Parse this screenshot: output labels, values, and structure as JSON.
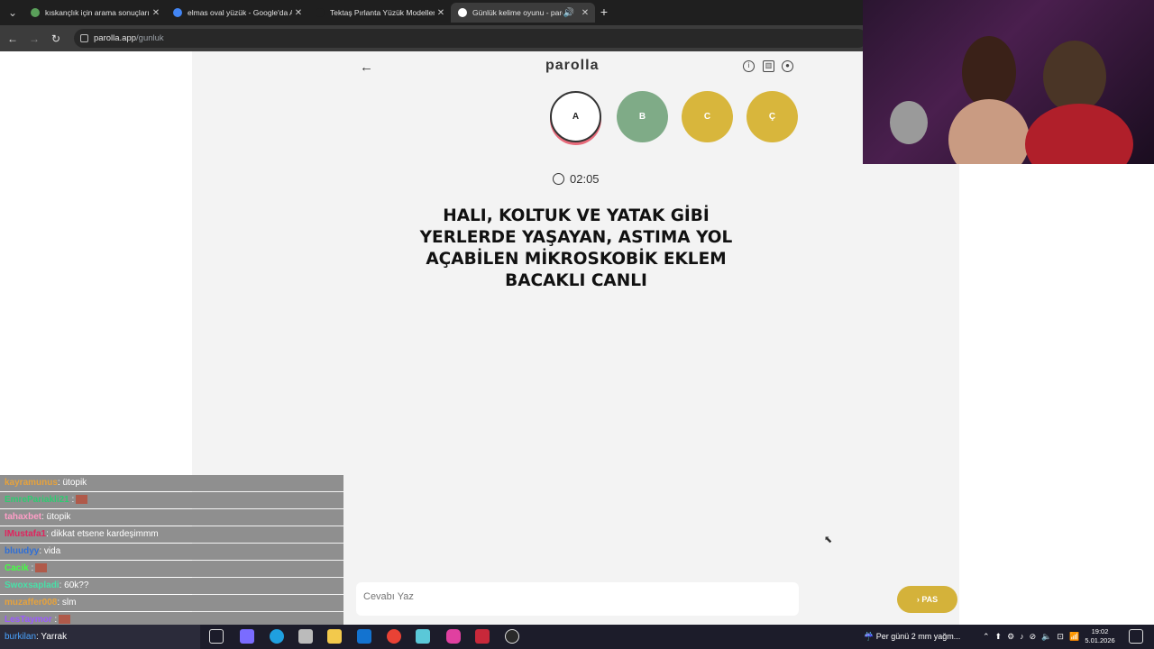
{
  "browser": {
    "tabs": [
      {
        "title": "kıskançlık için arama sonuçları -"
      },
      {
        "title": "elmas oval yüzük - Google'da A"
      },
      {
        "title": "Tektaş Pırlanta Yüzük Modelleri"
      },
      {
        "title": "Günlük kelime oyunu - paro"
      }
    ],
    "url_host": "parolla.app",
    "url_path": "/gunluk"
  },
  "game": {
    "logo": "parolla",
    "letters": [
      "A",
      "B",
      "C",
      "Ç"
    ],
    "timer": "02:05",
    "question": "HALI, KOLTUK VE YATAK GİBİ YERLERDE YAŞAYAN, ASTIMA YOL AÇABİLEN MİKROSKOBİK EKLEM BACAKLI CANLI",
    "answer_placeholder": "Cevabı Yaz",
    "pass_label": "PAS",
    "colors": {
      "correct": "#7fab87",
      "pending": "#d8b63c",
      "current_ring": "#e86a7a"
    }
  },
  "chat": [
    {
      "user": "kayramunus",
      "msg": ": ütopik",
      "color": "#e6a23c"
    },
    {
      "user": "EmrePariakli21",
      "msg": " :",
      "color": "#2ecc71"
    },
    {
      "user": "tahaxbet",
      "msg": ": ütopik",
      "color": "#ff9ec7"
    },
    {
      "user": "IMustafa1",
      "msg": ": dikkat etsene kardeşimmm",
      "color": "#e0245e"
    },
    {
      "user": "bluudyy",
      "msg": ": vida",
      "color": "#2f6fd6"
    },
    {
      "user": "Cacik",
      "msg": " :",
      "color": "#44ff44"
    },
    {
      "user": "Swoxsapladi",
      "msg": ": 60k??",
      "color": "#48e0a8"
    },
    {
      "user": "muzaffer008",
      "msg": ": slm",
      "color": "#e6a23c"
    },
    {
      "user": "LesTaymor",
      "msg": " :",
      "color": "#9b59ff"
    }
  ],
  "taskbar": {
    "search_user": "burkilan",
    "search_text": ": Yarrak",
    "weather": "Per günü 2 mm yağm...",
    "time": "19:02",
    "date": "5.01.2026"
  }
}
